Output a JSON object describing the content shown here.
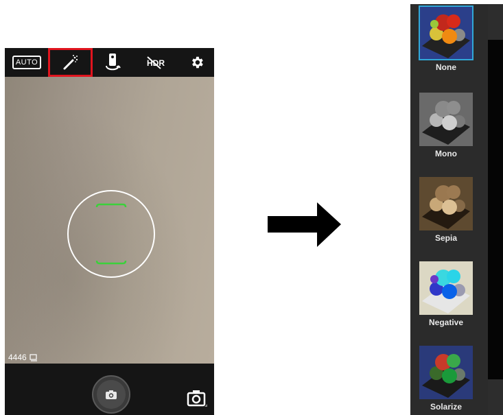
{
  "camera": {
    "topbar": {
      "auto_label": "AUTO",
      "icons": [
        "magic-wand-icon",
        "camera-flip-icon",
        "hdr-off-icon",
        "gear-icon"
      ]
    },
    "counter_text": "4446",
    "colors": {
      "bar": "#151515",
      "highlight": "#e0141e",
      "focus_brackets": "#3bd13b"
    }
  },
  "filters": {
    "selected": "None",
    "items": [
      {
        "label": "None"
      },
      {
        "label": "Mono"
      },
      {
        "label": "Sepia"
      },
      {
        "label": "Negative"
      },
      {
        "label": "Solarize"
      }
    ],
    "colors": {
      "selected_border": "#31a8d8",
      "panel": "#2b2b2b"
    }
  }
}
